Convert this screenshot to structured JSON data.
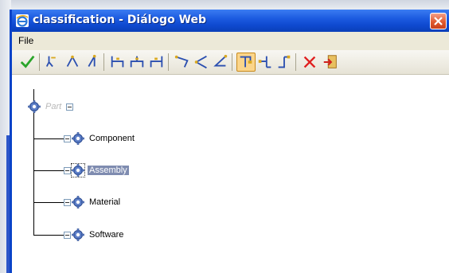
{
  "window": {
    "title": "classification - Diálogo Web"
  },
  "menu": {
    "items": [
      "File"
    ]
  },
  "toolbar": {
    "buttons": [
      {
        "icon": "checkmark-icon"
      },
      {
        "icon": "tree-down-left-icon"
      },
      {
        "icon": "tree-split-icon"
      },
      {
        "icon": "tree-down-right-icon"
      },
      {
        "icon": "bracket-left-icon"
      },
      {
        "icon": "bracket-center-icon"
      },
      {
        "icon": "bracket-right-icon"
      },
      {
        "icon": "branch-left-icon"
      },
      {
        "icon": "branch-center-icon"
      },
      {
        "icon": "branch-right-icon"
      },
      {
        "icon": "connector-left-icon",
        "active": true
      },
      {
        "icon": "connector-center-icon"
      },
      {
        "icon": "connector-right-icon"
      },
      {
        "icon": "delete-x-icon"
      },
      {
        "icon": "exit-door-icon"
      }
    ]
  },
  "tree": {
    "root": {
      "label": "Part",
      "expanded": true
    },
    "children": [
      {
        "label": "Component",
        "selected": false
      },
      {
        "label": "Assembly",
        "selected": true
      },
      {
        "label": "Material",
        "selected": false
      },
      {
        "label": "Software",
        "selected": false
      }
    ]
  },
  "colors": {
    "titlebar": "#1c5be0",
    "selection": "#7f8cb0",
    "close": "#e05a30",
    "checkmark": "#2aa52a",
    "delete": "#e02020"
  }
}
